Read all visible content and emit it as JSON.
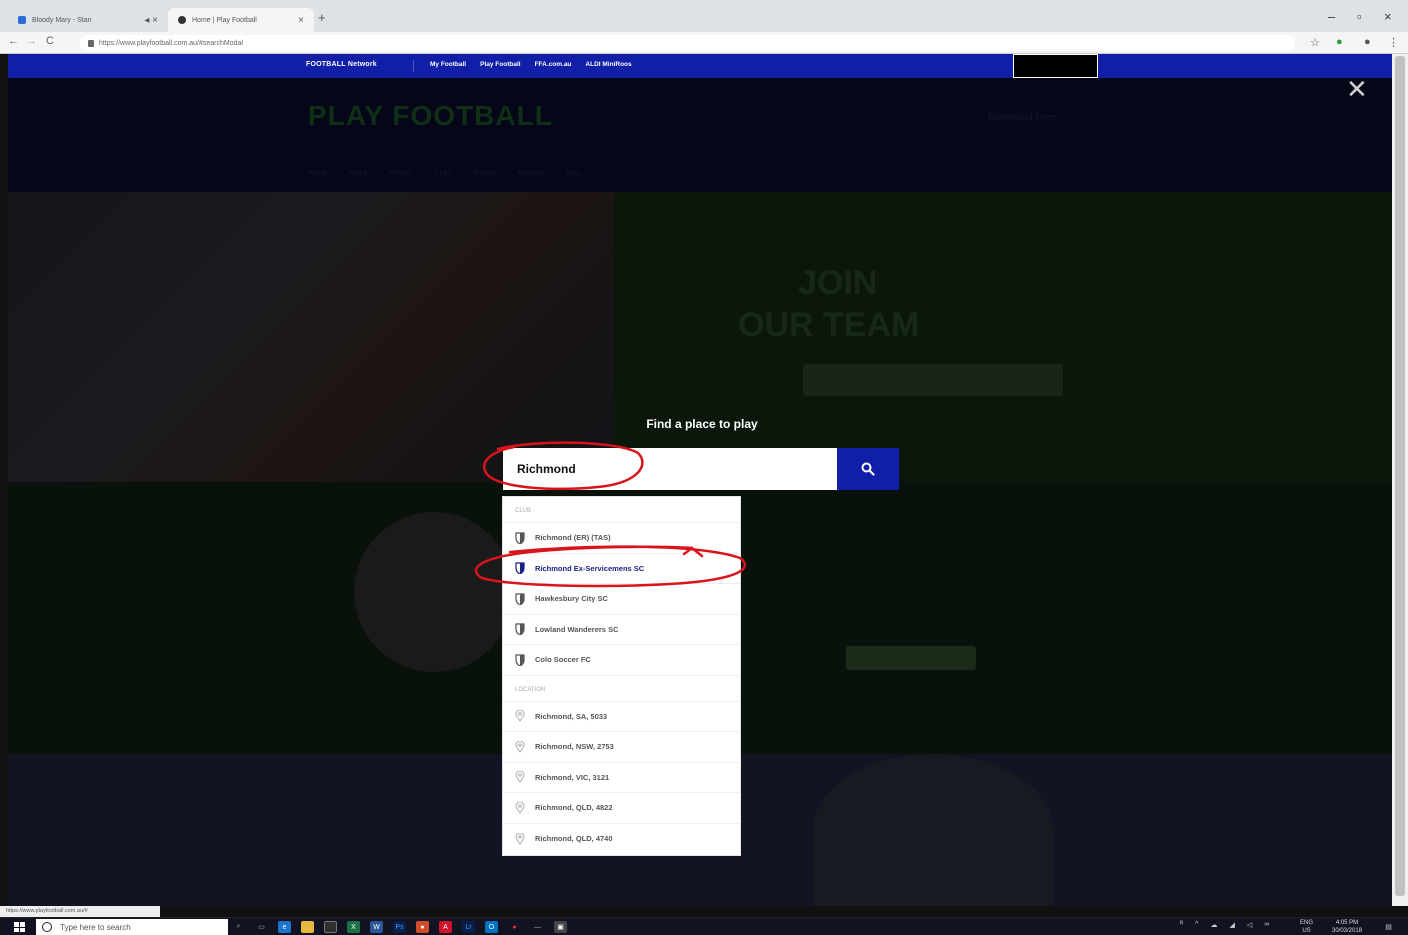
{
  "browser": {
    "tabs": [
      {
        "title": "Bloody Mary - Stan",
        "favicon_color": "#2a6bd6"
      },
      {
        "title": "Home | Play Football",
        "favicon_color": "#333333"
      }
    ],
    "url": "https://www.playfootball.com.au/#searchModal",
    "status_url": "https://www.playfootball.com.au/#"
  },
  "site": {
    "network_brand": "FOOTBALL",
    "network_label": "Network",
    "network_links": [
      "My Football",
      "Play Football",
      "FFA.com.au",
      "ALDI MiniRoos"
    ],
    "logo": "PLAY FOOTBALL",
    "header_right": "Download Free",
    "hero_lines": [
      "JOIN",
      "OUR TEAM"
    ],
    "nav_items": [
      "Home",
      "About",
      "Players",
      "Clubs",
      "Events",
      "Partners",
      "Help"
    ]
  },
  "modal": {
    "title": "Find a place to play",
    "search_value": "Richmond",
    "search_button_icon": "search-icon",
    "club_heading": "CLUB",
    "clubs": [
      {
        "label": "Richmond (ER) (TAS)",
        "highlighted": false
      },
      {
        "label": "Richmond Ex-Servicemens SC",
        "highlighted": true
      },
      {
        "label": "Hawkesbury City SC",
        "highlighted": false
      },
      {
        "label": "Lowland Wanderers SC",
        "highlighted": false
      },
      {
        "label": "Colo Soccer FC",
        "highlighted": false
      }
    ],
    "location_heading": "LOCATION",
    "locations": [
      "Richmond, SA, 5033",
      "Richmond, NSW, 2753",
      "Richmond, VIC, 3121",
      "Richmond, QLD, 4822",
      "Richmond, QLD, 4740"
    ],
    "accent_color": "#101ea8",
    "annotation_color": "#d8141c"
  },
  "taskbar": {
    "search_placeholder": "Type here to search",
    "language": "ENG",
    "region": "US",
    "time": "4:05 PM",
    "date": "30/03/2018"
  }
}
